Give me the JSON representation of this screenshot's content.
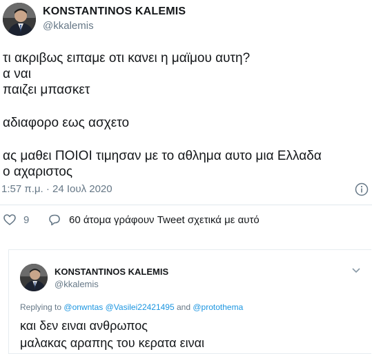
{
  "tweet": {
    "display_name": "KONSTANTINOS KALEMIS",
    "handle": "@kkalemis",
    "lines": [
      "τι ακριβως ειπαμε οτι κανει η μαϊμου αυτη?",
      "α ναι",
      "παιζει μπασκετ",
      "αδιαφορο εως ασχετο",
      "ας μαθει ΠΟΙΟΙ τιμησαν με το αθλημα αυτο μια Ελλαδα",
      "ο αχαριστος"
    ],
    "timestamp": "1:57 π.μ. · 24 Ιουλ 2020",
    "likes": "9",
    "conversation_text": "60 άτομα γράφουν Tweet σχετικά με αυτό"
  },
  "reply_tweet": {
    "display_name": "KONSTANTINOS KALEMIS",
    "handle": "@kkalemis",
    "replying_label": "Replying to",
    "mentions": [
      "@onwntas",
      "@Vasilei22421495",
      "@protothema"
    ],
    "and_word": "and",
    "lines": [
      "και δεν ειναι ανθρωπος",
      "μαλακας αραπης του κερατα ειναι"
    ]
  },
  "colors": {
    "link": "#1b95e0",
    "muted": "#657786",
    "text": "#14171a",
    "border": "#e1e8ed"
  },
  "icons": [
    "avatar",
    "info-icon",
    "heart-icon",
    "reply-bubble-icon",
    "chevron-down-icon"
  ]
}
